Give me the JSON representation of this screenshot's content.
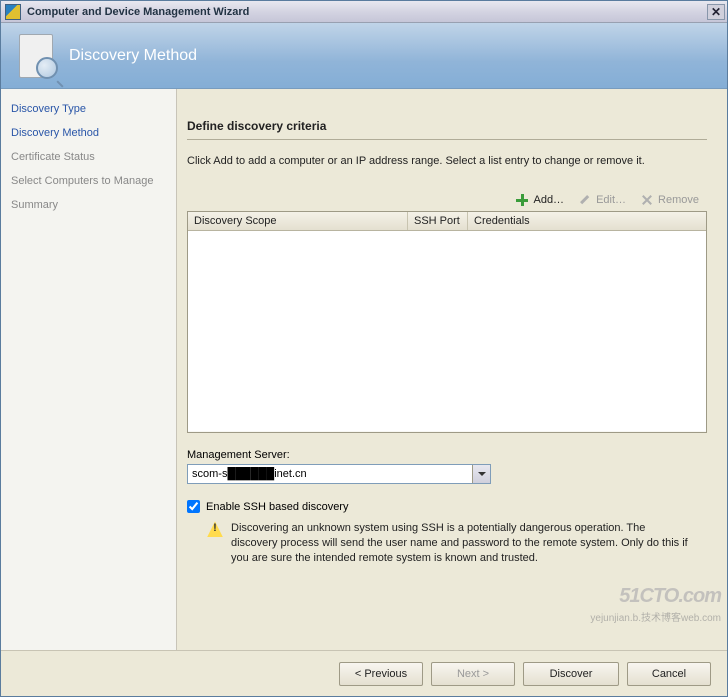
{
  "window": {
    "title": "Computer and Device Management Wizard"
  },
  "header": {
    "title": "Discovery Method"
  },
  "sidebar": {
    "steps": [
      {
        "label": "Discovery Type",
        "active": true
      },
      {
        "label": "Discovery Method",
        "active": true
      },
      {
        "label": "Certificate Status",
        "active": false
      },
      {
        "label": "Select Computers to Manage",
        "active": false
      },
      {
        "label": "Summary",
        "active": false
      }
    ]
  },
  "main": {
    "heading": "Define discovery criteria",
    "intro": "Click Add to add  a computer or an IP address range. Select a list entry to change or remove it.",
    "toolbar": {
      "add_label": "Add…",
      "edit_label": "Edit…",
      "remove_label": "Remove"
    },
    "grid": {
      "columns": {
        "scope": "Discovery Scope",
        "port": "SSH Port",
        "creds": "Credentials"
      },
      "rows": []
    },
    "mgmt_label": "Management Server:",
    "mgmt_value": "scom-s██████inet.cn",
    "ssh_checkbox_label": "Enable SSH based discovery",
    "ssh_checked": true,
    "warning": "Discovering an unknown system using SSH is a potentially dangerous operation. The discovery process will send the user name and password to the remote system. Only do this if you are sure the intended remote system is known and trusted."
  },
  "footer": {
    "previous": "< Previous",
    "next": "Next >",
    "discover": "Discover",
    "cancel": "Cancel"
  },
  "watermark": {
    "a": "51CTO.com",
    "b": "yejunjian.b.技术博客web.com"
  }
}
